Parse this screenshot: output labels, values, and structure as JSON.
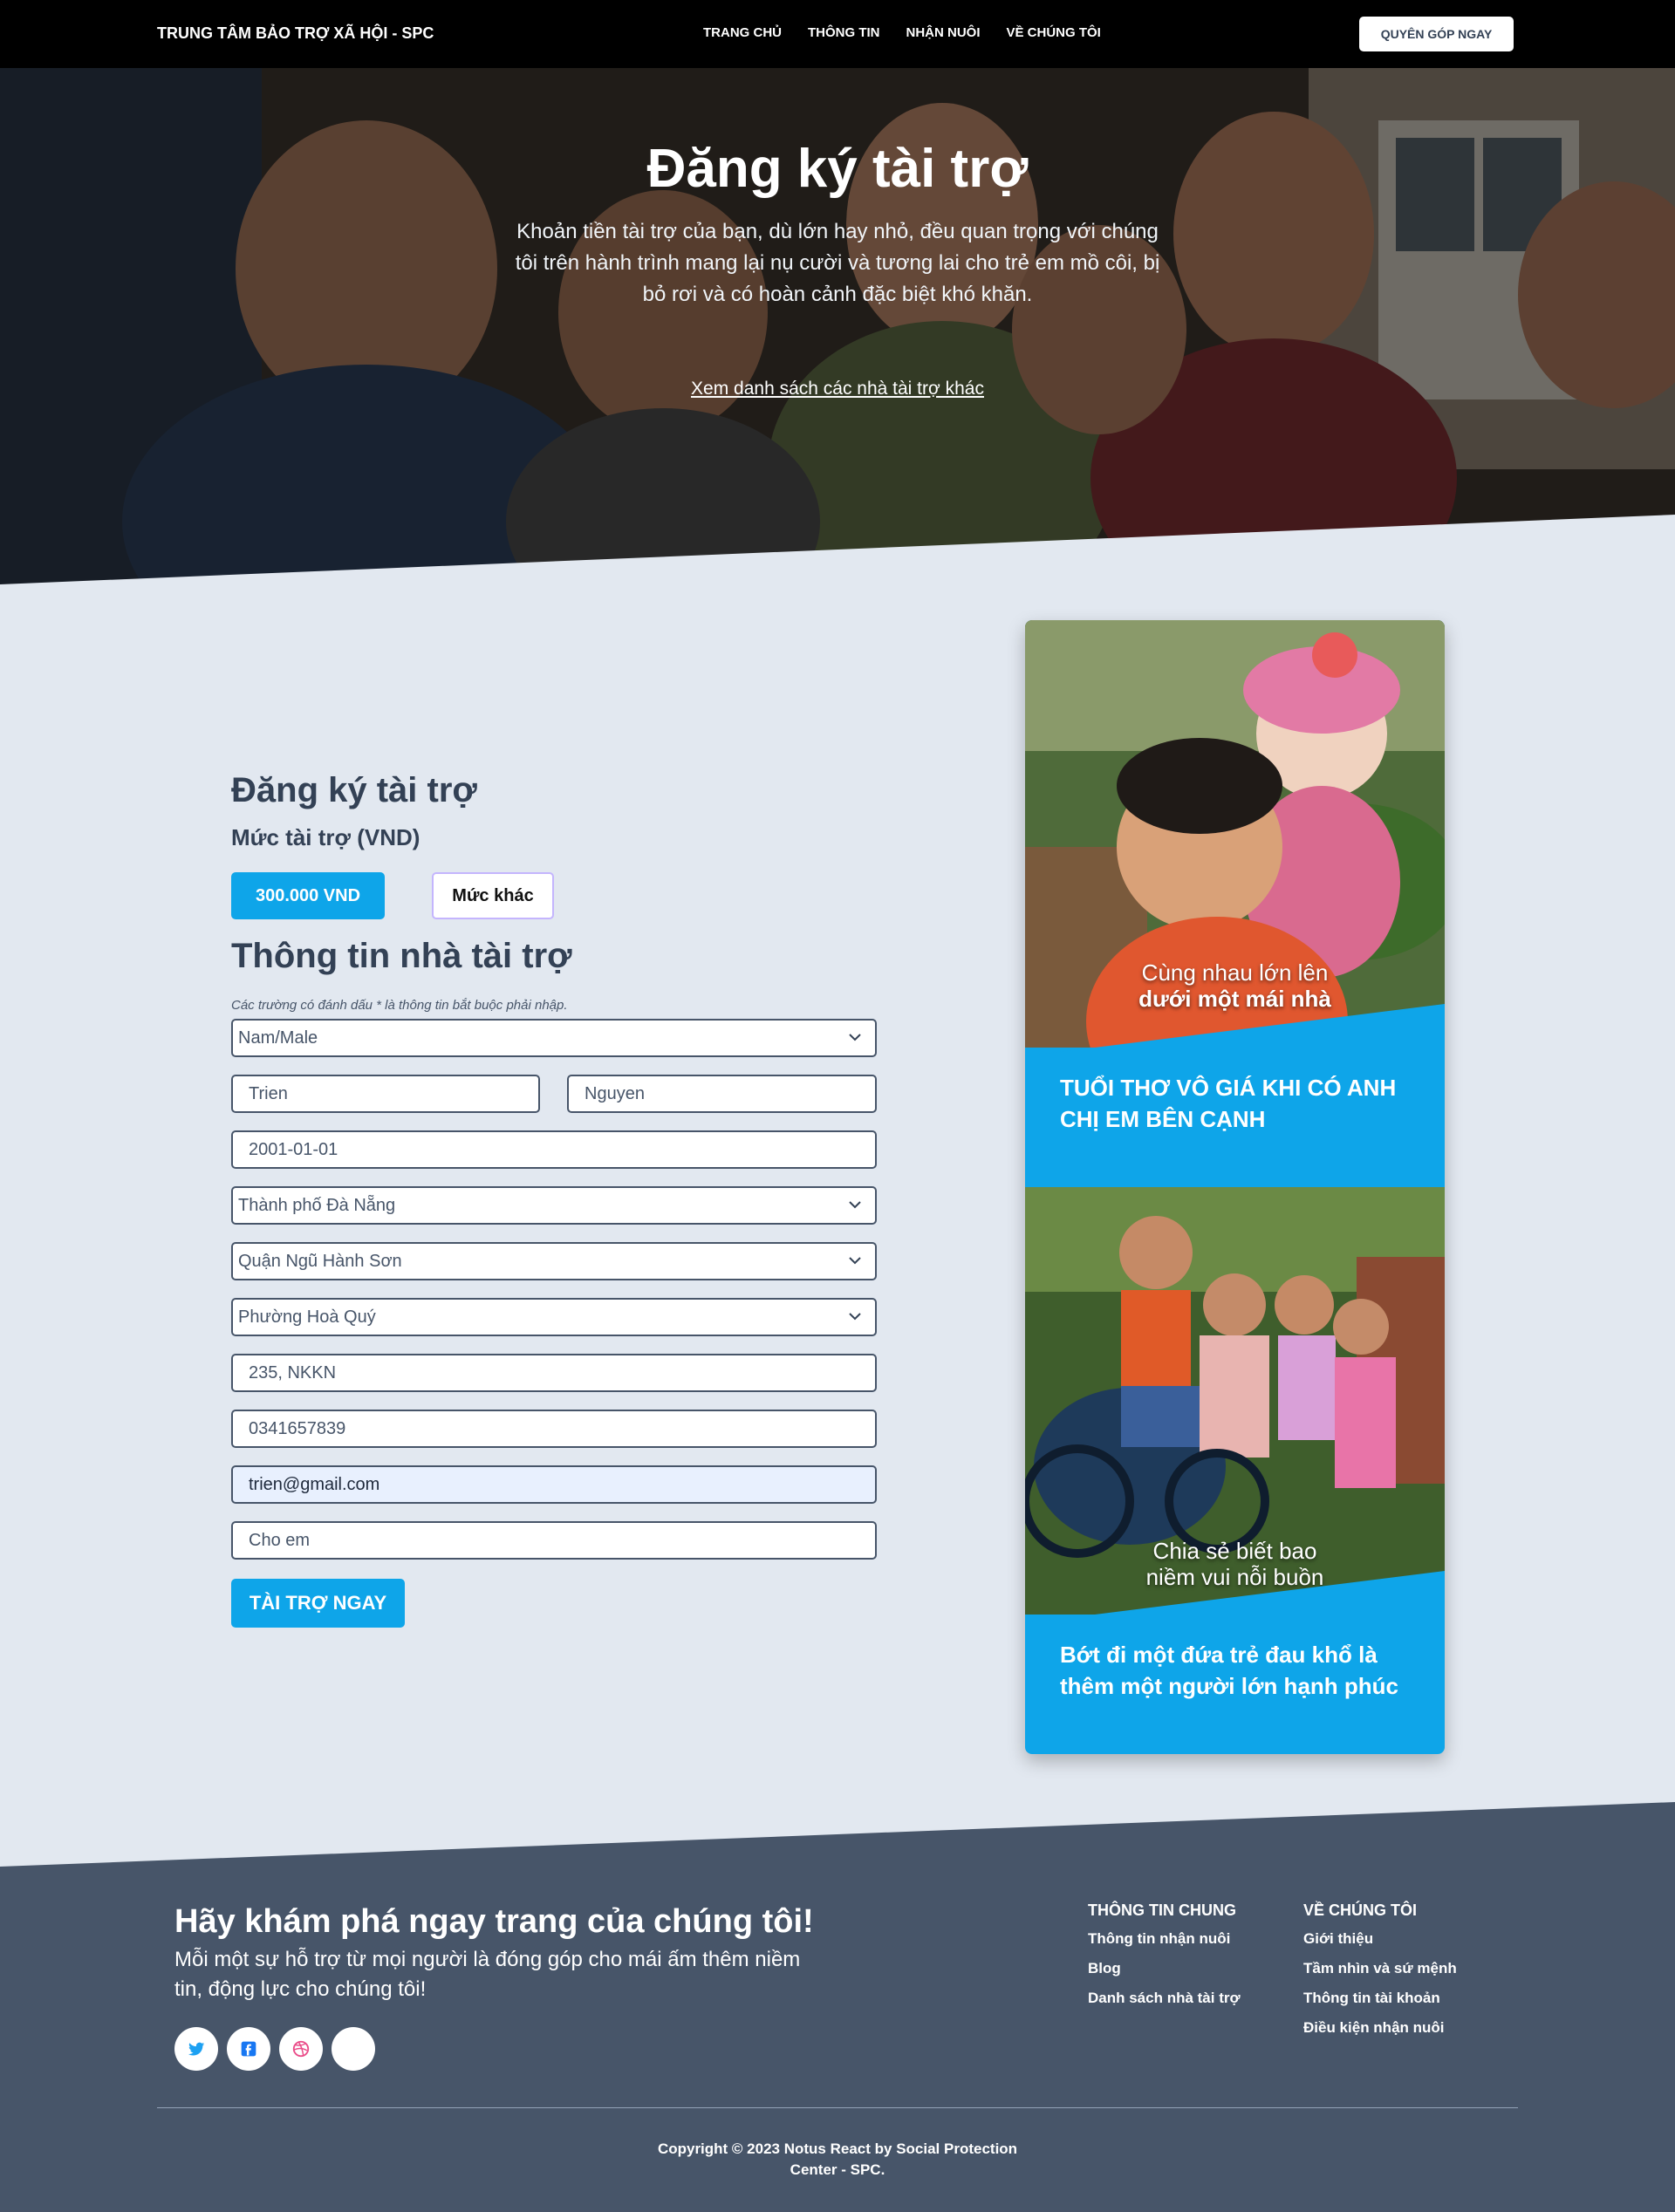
{
  "nav": {
    "brand": "TRUNG TÂM BẢO TRỢ XÃ HỘI - SPC",
    "items": [
      "TRANG CHỦ",
      "THÔNG TIN",
      "NHẬN NUÔI",
      "VỀ CHÚNG TÔI"
    ],
    "cta": "QUYÊN GÓP NGAY"
  },
  "hero": {
    "title": "Đăng ký tài trợ",
    "text": "Khoản tiền tài trợ của bạn, dù lớn hay nhỏ, đều quan trọng với chúng tôi trên hành trình mang lại nụ cười và tương lai cho trẻ em mồ côi, bị bỏ rơi và có hoàn cảnh đặc biệt khó khăn.",
    "link": "Xem danh sách các nhà tài trợ khác"
  },
  "form": {
    "title": "Đăng ký tài trợ",
    "amount_label": "Mức tài trợ (VND)",
    "amount_primary": "300.000 VND",
    "amount_other": "Mức khác",
    "info_title": "Thông tin nhà tài trợ",
    "hint": "Các trường có đánh dấu * là thông tin bắt buộc phải nhập.",
    "gender": "Nam/Male",
    "first_name": "Trien",
    "last_name": "Nguyen",
    "dob": "2001-01-01",
    "city": "Thành phố Đà Nẵng",
    "district": "Quận Ngũ Hành Sơn",
    "ward": "Phường Hoà Quý",
    "address": "235, NKKN",
    "phone": "0341657839",
    "email": "trien@gmail.com",
    "note": "Cho em",
    "submit": "TÀI TRỢ NGAY"
  },
  "card": {
    "caption1_line1": "Cùng nhau lớn lên",
    "caption1_line2": "dưới một mái nhà",
    "text1": "TUỔI THƠ VÔ GIÁ KHI CÓ ANH CHỊ EM BÊN CẠNH",
    "caption2_line1": "Chia sẻ biết bao",
    "caption2_line2": "niềm vui nỗi buồn",
    "text2": "Bớt đi một đứa trẻ đau khổ là thêm một người lớn hạnh phúc"
  },
  "footer": {
    "title": "Hãy khám phá ngay trang của chúng tôi!",
    "text": "Mỗi một sự hỗ trợ từ mọi người là đóng góp cho mái ấm thêm niềm tin, động lực cho chúng tôi!",
    "col1": {
      "head": "THÔNG TIN CHUNG",
      "items": [
        "Thông tin nhận nuôi",
        "Blog",
        "Danh sách nhà tài trợ"
      ]
    },
    "col2": {
      "head": "VỀ CHÚNG TÔI",
      "items": [
        "Giới thiệu",
        "Tầm nhìn và sứ mệnh",
        "Thông tin tài khoản",
        "Điều kiện nhận nuôi"
      ]
    },
    "copyright_line1": "Copyright © 2023 Notus React by Social Protection",
    "copyright_line2": "Center - SPC."
  },
  "colors": {
    "accent": "#0ea5e9",
    "nav_bg": "#000000",
    "page_bg": "#e2e8f0",
    "footer_bg": "#475569"
  }
}
